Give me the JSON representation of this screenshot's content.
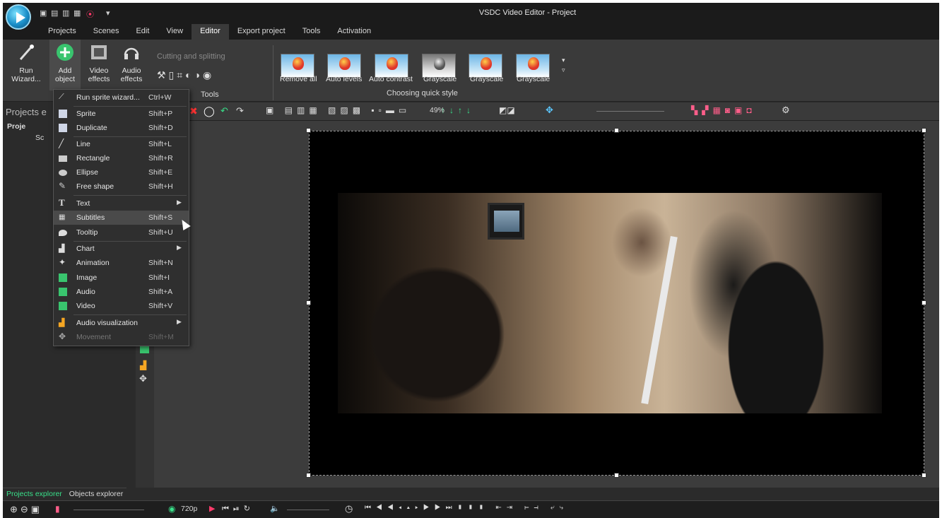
{
  "window": {
    "title": "VSDC Video Editor - Project"
  },
  "menu_tabs": [
    "Projects",
    "Scenes",
    "Edit",
    "View",
    "Editor",
    "Export project",
    "Tools",
    "Activation"
  ],
  "active_tab": "Editor",
  "ribbon": {
    "run_wizard": "Run\nWizard...",
    "add_object": "Add\nobject",
    "video_effects": "Video\neffects",
    "audio_effects": "Audio\neffects",
    "cutting": "Cutting and splitting",
    "tools_group": "Tools",
    "quick_style_group": "Choosing quick style",
    "quick_styles": [
      "Remove all",
      "Auto levels",
      "Auto contrast",
      "Grayscale",
      "Grayscale",
      "Grayscale"
    ]
  },
  "left_panel": {
    "title": "Projects e",
    "tree_root": "Proje",
    "tree_child": "Sc"
  },
  "toolbar": {
    "zoom": "49%"
  },
  "add_object_menu": [
    {
      "label": "Run sprite wizard...",
      "shortcut": "Ctrl+W",
      "icon": "wand-icon"
    },
    {
      "label": "Sprite",
      "shortcut": "Shift+P",
      "icon": "sprite-icon"
    },
    {
      "label": "Duplicate",
      "shortcut": "Shift+D",
      "icon": "duplicate-icon"
    },
    {
      "label": "Line",
      "shortcut": "Shift+L",
      "icon": "line-icon"
    },
    {
      "label": "Rectangle",
      "shortcut": "Shift+R",
      "icon": "rectangle-icon"
    },
    {
      "label": "Ellipse",
      "shortcut": "Shift+E",
      "icon": "ellipse-icon"
    },
    {
      "label": "Free shape",
      "shortcut": "Shift+H",
      "icon": "free-shape-icon"
    },
    {
      "label": "Text",
      "shortcut": "",
      "icon": "text-icon",
      "submenu": true
    },
    {
      "label": "Subtitles",
      "shortcut": "Shift+S",
      "icon": "subtitles-icon",
      "highlighted": true
    },
    {
      "label": "Tooltip",
      "shortcut": "Shift+U",
      "icon": "tooltip-icon"
    },
    {
      "label": "Chart",
      "shortcut": "",
      "icon": "chart-icon",
      "submenu": true
    },
    {
      "label": "Animation",
      "shortcut": "Shift+N",
      "icon": "animation-icon"
    },
    {
      "label": "Image",
      "shortcut": "Shift+I",
      "icon": "image-icon"
    },
    {
      "label": "Audio",
      "shortcut": "Shift+A",
      "icon": "audio-icon"
    },
    {
      "label": "Video",
      "shortcut": "Shift+V",
      "icon": "video-icon"
    },
    {
      "label": "Audio visualization",
      "shortcut": "",
      "icon": "audio-visualization-icon",
      "submenu": true
    },
    {
      "label": "Movement",
      "shortcut": "Shift+M",
      "icon": "movement-icon",
      "disabled": true
    }
  ],
  "bottom_tabs": [
    "Projects explorer",
    "Objects explorer"
  ],
  "status": {
    "resolution": "720p"
  },
  "colors": {
    "accent_green": "#39e08a",
    "dark_bg": "#2b2b2b",
    "ribbon_bg": "#3a3a3a"
  }
}
